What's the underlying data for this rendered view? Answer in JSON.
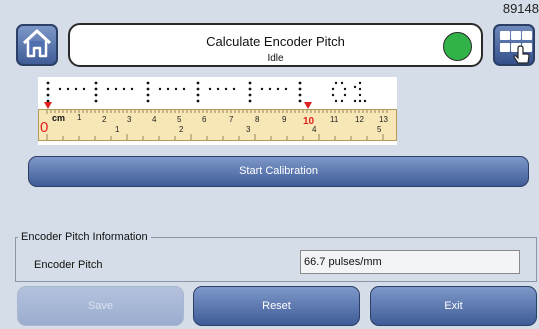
{
  "corner_id": "89148",
  "header": {
    "title": "Calculate Encoder Pitch",
    "status": "Idle",
    "status_color": "#32b34a",
    "home_icon": "home-icon",
    "menu_icon": "grid-touch-icon"
  },
  "ruler": {
    "zero_label": "0",
    "unit_label": "cm",
    "highlight_label": "10",
    "top_numbers": [
      "1",
      "2",
      "3",
      "4",
      "5",
      "6",
      "7",
      "8",
      "9",
      "11",
      "12",
      "13"
    ],
    "bottom_numbers": [
      "1",
      "2",
      "3",
      "4",
      "5"
    ],
    "marker_color": "#e02020"
  },
  "start_button": {
    "label": "Start Calibration"
  },
  "info": {
    "group_title": "Encoder Pitch Information",
    "encoder_pitch_label": "Encoder Pitch",
    "encoder_pitch_value": "66.7 pulses/mm"
  },
  "footer": {
    "save_label": "Save",
    "reset_label": "Reset",
    "exit_label": "Exit"
  }
}
